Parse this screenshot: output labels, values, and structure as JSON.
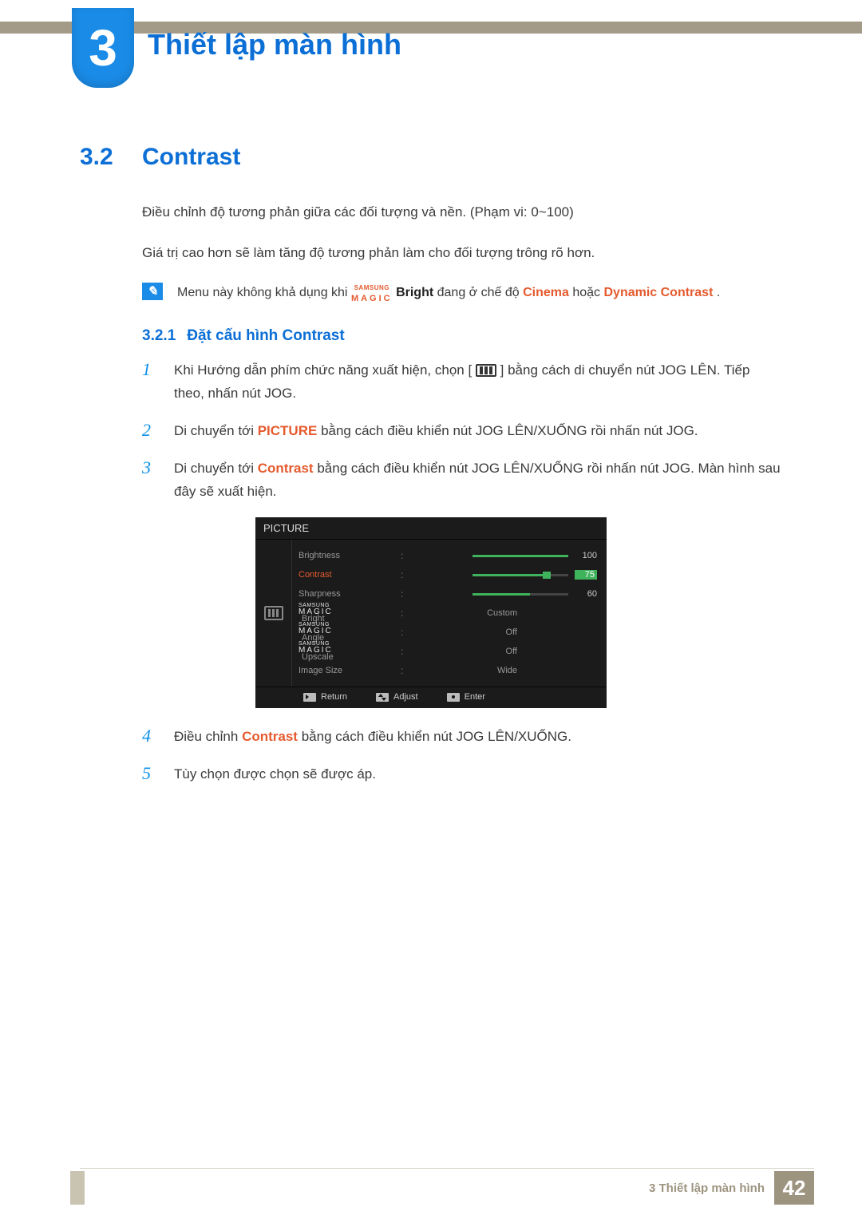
{
  "chapter": {
    "num": "3",
    "title": "Thiết lập màn hình"
  },
  "section": {
    "num": "3.2",
    "title": "Contrast"
  },
  "intro": {
    "p1": "Điều chỉnh độ tương phản giữa các đối tượng và nền. (Phạm vi: 0~100)",
    "p2": "Giá trị cao hơn sẽ làm tăng độ tương phản làm cho đối tượng trông rõ hơn."
  },
  "note": {
    "t1": "Menu này không khả dụng khi ",
    "magic_top": "SAMSUNG",
    "magic_bottom": "MAGIC",
    "bright": "Bright",
    "t2": " đang ở chế độ ",
    "cinema": "Cinema",
    "t3": " hoặc ",
    "dyn": "Dynamic Contrast",
    "t4": "."
  },
  "subsection": {
    "num": "3.2.1",
    "title": "Đặt cấu hình Contrast"
  },
  "steps": {
    "s1a": "Khi Hướng dẫn phím chức năng xuất hiện, chọn [",
    "s1b": "] bằng cách di chuyển nút JOG LÊN. Tiếp theo, nhấn nút JOG.",
    "s2a": "Di chuyển tới ",
    "s2_pic": "PICTURE",
    "s2b": " bằng cách điều khiển nút JOG LÊN/XUỐNG rồi nhấn nút JOG.",
    "s3a": "Di chuyển tới ",
    "s3_con": "Contrast",
    "s3b": " bằng cách điều khiển nút JOG LÊN/XUỐNG rồi nhấn nút JOG. Màn hình sau đây sẽ xuất hiện.",
    "s4a": "Điều chỉnh ",
    "s4_con": "Contrast",
    "s4b": " bằng cách điều khiển nút JOG LÊN/XUỐNG.",
    "s5": "Tùy chọn được chọn sẽ được áp."
  },
  "osd": {
    "title": "PICTURE",
    "rows": {
      "brightness": {
        "label": "Brightness",
        "value": 100,
        "fill": 100
      },
      "contrast": {
        "label": "Contrast",
        "value": 75,
        "fill": 75
      },
      "sharpness": {
        "label": "Sharpness",
        "value": 60,
        "fill": 60
      },
      "magic_bright": {
        "suffix": "Bright",
        "value": "Custom"
      },
      "magic_angle": {
        "suffix": "Angle",
        "value": "Off"
      },
      "magic_upscale": {
        "suffix": "Upscale",
        "value": "Off"
      },
      "image_size": {
        "label": "Image Size",
        "value": "Wide"
      }
    },
    "magic": {
      "top": "SAMSUNG",
      "bottom": "MAGIC"
    },
    "footer": {
      "return": "Return",
      "adjust": "Adjust",
      "enter": "Enter"
    }
  },
  "footer": {
    "text": "3 Thiết lập màn hình",
    "page": "42"
  }
}
